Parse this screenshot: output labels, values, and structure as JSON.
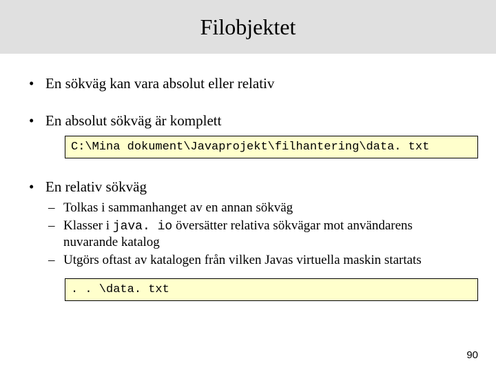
{
  "title": "Filobjektet",
  "bullets": {
    "b1": "En sökväg kan vara absolut eller relativ",
    "b2": "En absolut sökväg är komplett",
    "b3": "En relativ sökväg"
  },
  "code": {
    "abs": "C:\\Mina dokument\\Javaprojekt\\filhantering\\data. txt",
    "rel": ". . \\data. txt"
  },
  "sub": {
    "s1": "Tolkas i sammanhanget av en annan sökväg",
    "s2a": "Klasser i ",
    "s2code": "java. io",
    "s2b": " översätter relativa sökvägar mot användarens nuvarande katalog",
    "s3": "Utgörs oftast av katalogen från vilken Javas virtuella maskin startats"
  },
  "page": "90"
}
